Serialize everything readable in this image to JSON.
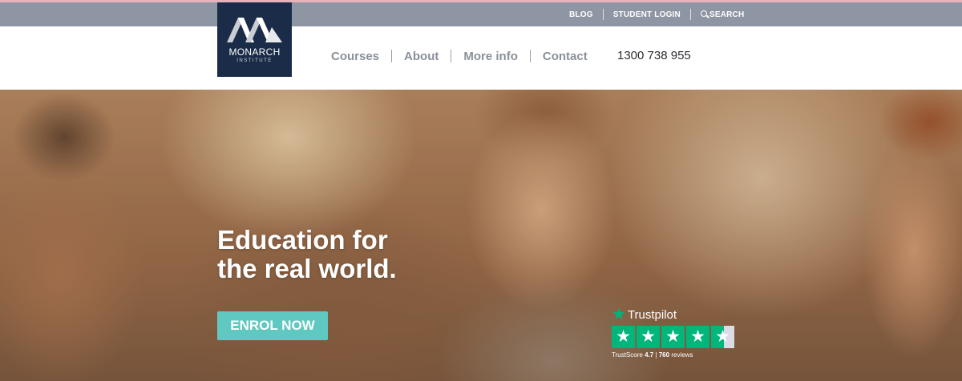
{
  "topbar": {
    "links": [
      "BLOG",
      "STUDENT LOGIN",
      "SEARCH"
    ]
  },
  "logo": {
    "name": "MONARCH",
    "subtitle": "INSTITUTE"
  },
  "nav": {
    "items": [
      "Courses",
      "About",
      "More info",
      "Contact"
    ],
    "phone": "1300 738 955"
  },
  "hero": {
    "headline_line1": "Education for",
    "headline_line2": "the real world.",
    "cta_label": "ENROL NOW"
  },
  "trustpilot": {
    "brand": "Trustpilot",
    "score_label": "TrustScore",
    "score": "4.7",
    "separator": "|",
    "reviews": "760",
    "reviews_label": "reviews",
    "rating": 4.5
  },
  "colors": {
    "topbar": "#8f96a3",
    "logo_bg": "#1a2c48",
    "cta": "#5fc8c0",
    "trustpilot_green": "#00b67a"
  }
}
